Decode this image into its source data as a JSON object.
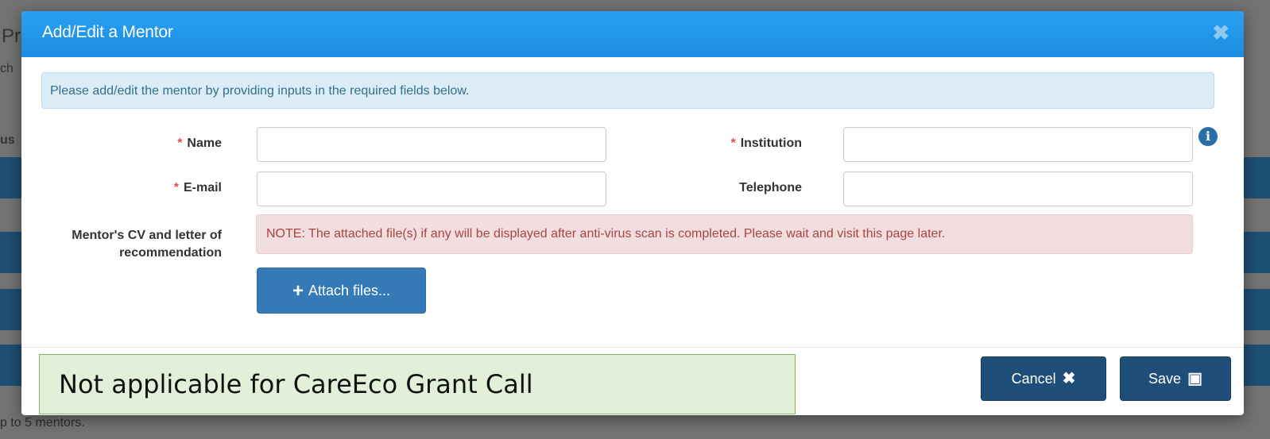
{
  "background": {
    "frag_title": "Pr",
    "frag_ch": "ch",
    "frag_us": "us",
    "footer_text": "p to 5 mentors."
  },
  "modal": {
    "title": "Add/Edit a Mentor",
    "close_icon": "close-icon",
    "info_text": "Please add/edit the mentor by providing inputs in the required fields below.",
    "fields": {
      "name": {
        "label": "Name",
        "required": "*",
        "value": ""
      },
      "institution": {
        "label": "Institution",
        "required": "*",
        "value": ""
      },
      "email": {
        "label": "E-mail",
        "required": "*",
        "value": ""
      },
      "telephone": {
        "label": "Telephone",
        "value": ""
      }
    },
    "cv_label": "Mentor's CV and letter of recommendation",
    "note_text": "NOTE: The attached file(s) if any will be displayed after anti-virus scan is completed. Please wait and visit this page later.",
    "attach_button": "Attach files...",
    "cancel_button": "Cancel",
    "save_button": "Save"
  },
  "overlay_note": "Not applicable for CareEco Grant Call",
  "colors": {
    "header": "#1f8fe4",
    "primary_button": "#337ab7",
    "dark_button": "#1f4e79",
    "required": "#d9534f"
  }
}
